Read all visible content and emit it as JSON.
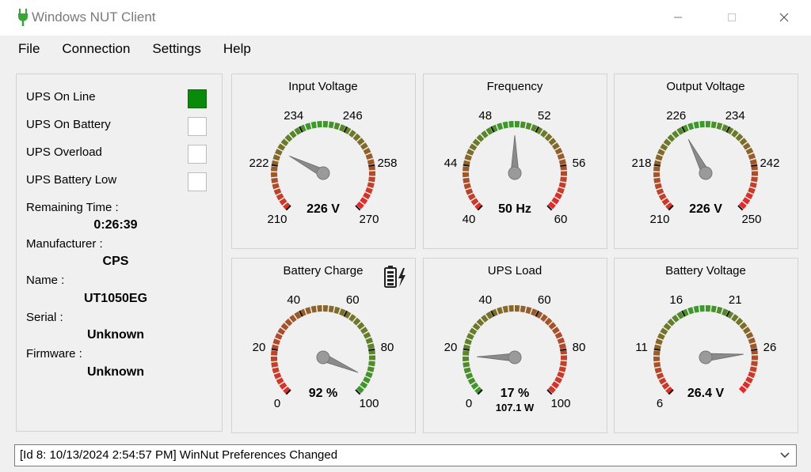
{
  "window": {
    "title": "Windows NUT Client"
  },
  "menu": [
    "File",
    "Connection",
    "Settings",
    "Help"
  ],
  "status_panel": {
    "indicators": [
      {
        "label": "UPS On Line",
        "active": true,
        "color": "#0a8a0a"
      },
      {
        "label": "UPS On Battery",
        "active": false
      },
      {
        "label": "UPS Overload",
        "active": false
      },
      {
        "label": "UPS Battery Low",
        "active": false
      }
    ],
    "remaining_time_label": "Remaining Time :",
    "remaining_time": "0:26:39",
    "manufacturer_label": "Manufacturer :",
    "manufacturer": "CPS",
    "name_label": "Name :",
    "name": "UT1050EG",
    "serial_label": "Serial :",
    "serial": "Unknown",
    "firmware_label": "Firmware :",
    "firmware": "Unknown"
  },
  "gauges": [
    {
      "id": "input-voltage",
      "title": "Input Voltage",
      "min": 210,
      "max": 270,
      "value": 226,
      "labels": [
        "210",
        "222",
        "234",
        "246",
        "258",
        "270"
      ],
      "display": "226 V",
      "subtext": "",
      "zones": "red-green-red",
      "icon": ""
    },
    {
      "id": "frequency",
      "title": "Frequency",
      "min": 40,
      "max": 60,
      "value": 50,
      "labels": [
        "40",
        "44",
        "48",
        "52",
        "56",
        "60"
      ],
      "display": "50 Hz",
      "subtext": "",
      "zones": "red-green-red",
      "icon": ""
    },
    {
      "id": "output-voltage",
      "title": "Output Voltage",
      "min": 210,
      "max": 250,
      "value": 226,
      "labels": [
        "210",
        "218",
        "226",
        "234",
        "242",
        "250"
      ],
      "display": "226 V",
      "subtext": "",
      "zones": "red-green-red",
      "icon": ""
    },
    {
      "id": "battery-charge",
      "title": "Battery Charge",
      "min": 0,
      "max": 100,
      "value": 92,
      "labels": [
        "0",
        "20",
        "40",
        "60",
        "80",
        "100"
      ],
      "display": "92 %",
      "subtext": "",
      "zones": "red-to-green",
      "icon": "battery-charging-icon"
    },
    {
      "id": "ups-load",
      "title": "UPS Load",
      "min": 0,
      "max": 100,
      "value": 17,
      "labels": [
        "0",
        "20",
        "40",
        "60",
        "80",
        "100"
      ],
      "display": "17 %",
      "subtext": "107.1 W",
      "zones": "green-to-red",
      "icon": ""
    },
    {
      "id": "battery-voltage",
      "title": "Battery Voltage",
      "min": 6,
      "max": 31,
      "value": 26.4,
      "labels": [
        "6",
        "11",
        "16",
        "21",
        "26"
      ],
      "display": "26.4 V",
      "subtext": "",
      "zones": "red-green-red",
      "icon": ""
    }
  ],
  "statusbar": {
    "text": "[Id 8: 10/13/2024 2:54:57 PM] WinNut Preferences Changed"
  }
}
